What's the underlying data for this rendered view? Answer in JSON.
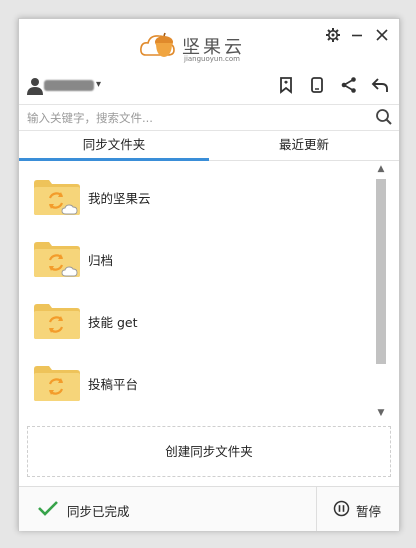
{
  "app": {
    "brand_name": "坚果云",
    "brand_sub": "jianguoyun.com"
  },
  "toolbar": {
    "user_caret": "▾"
  },
  "search": {
    "placeholder": "输入关键字，搜索文件..."
  },
  "tabs": [
    {
      "label": "同步文件夹",
      "active": true
    },
    {
      "label": "最近更新",
      "active": false
    }
  ],
  "folders": [
    {
      "name": "我的坚果云",
      "cloud_badge": true
    },
    {
      "name": "归档",
      "cloud_badge": true
    },
    {
      "name": "技能 get",
      "cloud_badge": false
    },
    {
      "name": "投稿平台",
      "cloud_badge": false
    }
  ],
  "scrollbar": {
    "up": "▲",
    "down": "▼"
  },
  "create_button": {
    "label": "创建同步文件夹"
  },
  "status": {
    "text": "同步已完成",
    "pause_label": "暂停"
  },
  "colors": {
    "accent": "#3a8ed8",
    "folder": "#f6d57a",
    "folder_dark": "#eec35a",
    "sync_arrows": "#f39c2b",
    "check": "#37a34a",
    "logo": "#e08a2c"
  }
}
